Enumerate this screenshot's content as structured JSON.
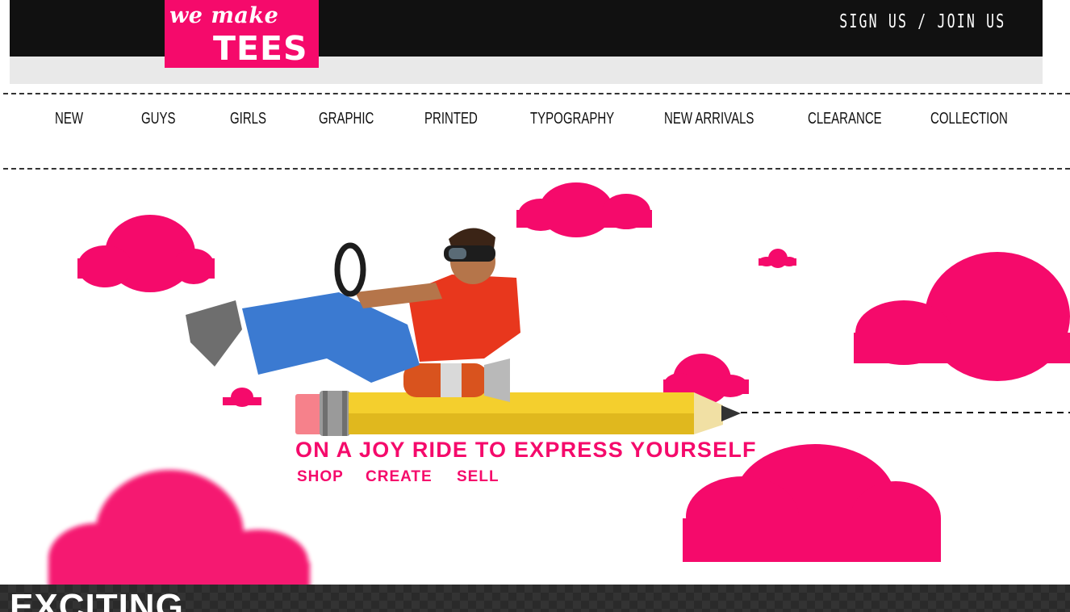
{
  "header": {
    "logo_line1": "we make",
    "logo_line2": "TEES",
    "auth_link": "SIGN US / JOIN US"
  },
  "nav": {
    "items": [
      "NEW",
      "GUYS",
      "GIRLS",
      "GRAPHIC",
      "PRINTED",
      "TYPOGRAPHY",
      "NEW ARRIVALS",
      "CLEARANCE",
      "COLLECTION"
    ]
  },
  "hero": {
    "tagline": "ON A JOY RIDE TO EXPRESS YOURSELF",
    "links": [
      "SHOP",
      "CREATE",
      "SELL"
    ]
  },
  "bottom": {
    "heading": "EXCITING"
  },
  "colors": {
    "brand_pink": "#f50a6b",
    "header_black": "#111111",
    "header_grey": "#e9e9e9",
    "pencil_yellow": "#f4cf2d"
  },
  "icons": [
    "cloud-icon",
    "pencil-icon",
    "steering-wheel-icon",
    "goggles-icon",
    "rocket-booster-icon"
  ]
}
